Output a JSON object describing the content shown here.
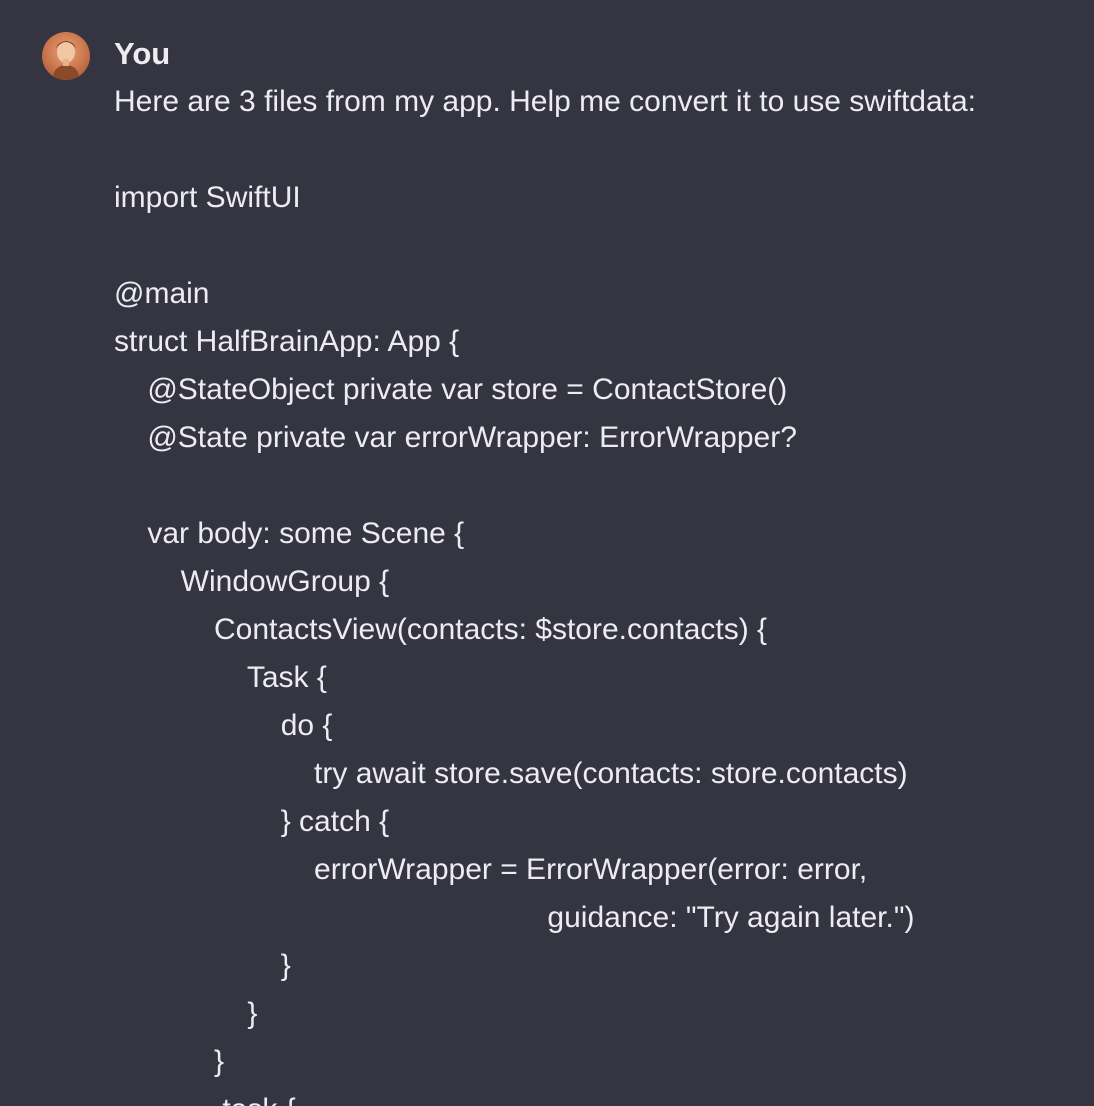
{
  "message": {
    "author": "You",
    "avatar_icon": "user-avatar",
    "lines": [
      "Here are 3 files from my app. Help me convert it to use swiftdata:",
      "",
      "import SwiftUI",
      "",
      "@main",
      "struct HalfBrainApp: App {",
      "    @StateObject private var store = ContactStore()",
      "    @State private var errorWrapper: ErrorWrapper?",
      "",
      "    var body: some Scene {",
      "        WindowGroup {",
      "            ContactsView(contacts: $store.contacts) {",
      "                Task {",
      "                    do {",
      "                        try await store.save(contacts: store.contacts)",
      "                    } catch {",
      "                        errorWrapper = ErrorWrapper(error: error,",
      "                                                    guidance: \"Try again later.\")",
      "                    }",
      "                }",
      "            }",
      "            .task {"
    ]
  },
  "colors": {
    "background": "#343541",
    "text": "#ececf1"
  }
}
